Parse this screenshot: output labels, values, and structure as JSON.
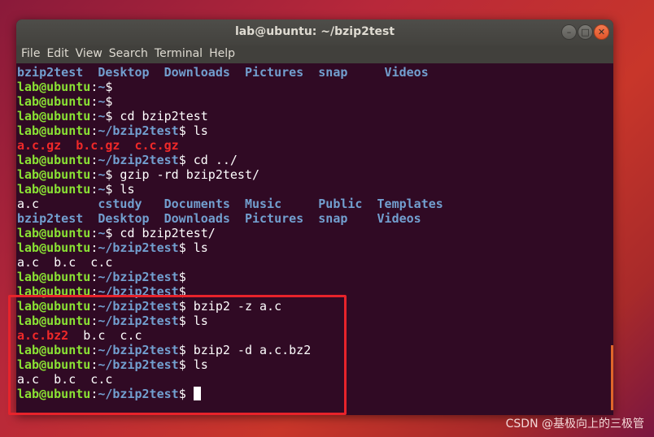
{
  "window": {
    "title": "lab@ubuntu: ~/bzip2test",
    "buttons": [
      "minimize",
      "maximize",
      "close"
    ]
  },
  "menu": [
    "File",
    "Edit",
    "View",
    "Search",
    "Terminal",
    "Help"
  ],
  "colors": {
    "prompt": "#8ae234",
    "path": "#729fcf",
    "archive": "#ef2929",
    "background": "#300a24",
    "highlight": "#e8232b"
  },
  "lines": [
    [
      [
        "b",
        "bzip2test  Desktop  Downloads  Pictures  snap     Videos"
      ]
    ],
    [
      [
        "g",
        "lab@ubuntu"
      ],
      [
        "w",
        ":"
      ],
      [
        "b",
        "~"
      ],
      [
        "w",
        "$"
      ]
    ],
    [
      [
        "g",
        "lab@ubuntu"
      ],
      [
        "w",
        ":"
      ],
      [
        "b",
        "~"
      ],
      [
        "w",
        "$"
      ]
    ],
    [
      [
        "g",
        "lab@ubuntu"
      ],
      [
        "w",
        ":"
      ],
      [
        "b",
        "~"
      ],
      [
        "w",
        "$ cd bzip2test"
      ]
    ],
    [
      [
        "g",
        "lab@ubuntu"
      ],
      [
        "w",
        ":"
      ],
      [
        "b",
        "~/bzip2test"
      ],
      [
        "w",
        "$ ls"
      ]
    ],
    [
      [
        "r",
        "a.c.gz"
      ],
      [
        "w",
        "  "
      ],
      [
        "r",
        "b.c.gz"
      ],
      [
        "w",
        "  "
      ],
      [
        "r",
        "c.c.gz"
      ]
    ],
    [
      [
        "g",
        "lab@ubuntu"
      ],
      [
        "w",
        ":"
      ],
      [
        "b",
        "~/bzip2test"
      ],
      [
        "w",
        "$ cd ../"
      ]
    ],
    [
      [
        "g",
        "lab@ubuntu"
      ],
      [
        "w",
        ":"
      ],
      [
        "b",
        "~"
      ],
      [
        "w",
        "$ gzip -rd bzip2test/"
      ]
    ],
    [
      [
        "g",
        "lab@ubuntu"
      ],
      [
        "w",
        ":"
      ],
      [
        "b",
        "~"
      ],
      [
        "w",
        "$ ls"
      ]
    ],
    [
      [
        "w",
        "a.c        "
      ],
      [
        "b",
        "cstudy"
      ],
      [
        "w",
        "   "
      ],
      [
        "b",
        "Documents"
      ],
      [
        "w",
        "  "
      ],
      [
        "b",
        "Music"
      ],
      [
        "w",
        "     "
      ],
      [
        "b",
        "Public"
      ],
      [
        "w",
        "  "
      ],
      [
        "b",
        "Templates"
      ]
    ],
    [
      [
        "b",
        "bzip2test"
      ],
      [
        "w",
        "  "
      ],
      [
        "b",
        "Desktop"
      ],
      [
        "w",
        "  "
      ],
      [
        "b",
        "Downloads"
      ],
      [
        "w",
        "  "
      ],
      [
        "b",
        "Pictures"
      ],
      [
        "w",
        "  "
      ],
      [
        "b",
        "snap"
      ],
      [
        "w",
        "    "
      ],
      [
        "b",
        "Videos"
      ]
    ],
    [
      [
        "g",
        "lab@ubuntu"
      ],
      [
        "w",
        ":"
      ],
      [
        "b",
        "~"
      ],
      [
        "w",
        "$ cd bzip2test/"
      ]
    ],
    [
      [
        "g",
        "lab@ubuntu"
      ],
      [
        "w",
        ":"
      ],
      [
        "b",
        "~/bzip2test"
      ],
      [
        "w",
        "$ ls"
      ]
    ],
    [
      [
        "w",
        "a.c  b.c  c.c"
      ]
    ],
    [
      [
        "g",
        "lab@ubuntu"
      ],
      [
        "w",
        ":"
      ],
      [
        "b",
        "~/bzip2test"
      ],
      [
        "w",
        "$"
      ]
    ],
    [
      [
        "g",
        "lab@ubuntu"
      ],
      [
        "w",
        ":"
      ],
      [
        "b",
        "~/bzip2test"
      ],
      [
        "w",
        "$"
      ]
    ],
    [
      [
        "g",
        "lab@ubuntu"
      ],
      [
        "w",
        ":"
      ],
      [
        "b",
        "~/bzip2test"
      ],
      [
        "w",
        "$ bzip2 -z a.c"
      ]
    ],
    [
      [
        "g",
        "lab@ubuntu"
      ],
      [
        "w",
        ":"
      ],
      [
        "b",
        "~/bzip2test"
      ],
      [
        "w",
        "$ ls"
      ]
    ],
    [
      [
        "r",
        "a.c.bz2"
      ],
      [
        "w",
        "  b.c  c.c"
      ]
    ],
    [
      [
        "g",
        "lab@ubuntu"
      ],
      [
        "w",
        ":"
      ],
      [
        "b",
        "~/bzip2test"
      ],
      [
        "w",
        "$ bzip2 -d a.c.bz2"
      ]
    ],
    [
      [
        "g",
        "lab@ubuntu"
      ],
      [
        "w",
        ":"
      ],
      [
        "b",
        "~/bzip2test"
      ],
      [
        "w",
        "$ ls"
      ]
    ],
    [
      [
        "w",
        "a.c  b.c  c.c"
      ]
    ],
    [
      [
        "g",
        "lab@ubuntu"
      ],
      [
        "w",
        ":"
      ],
      [
        "b",
        "~/bzip2test"
      ],
      [
        "w",
        "$ "
      ]
    ]
  ],
  "watermark": "CSDN @基极向上的三极管"
}
